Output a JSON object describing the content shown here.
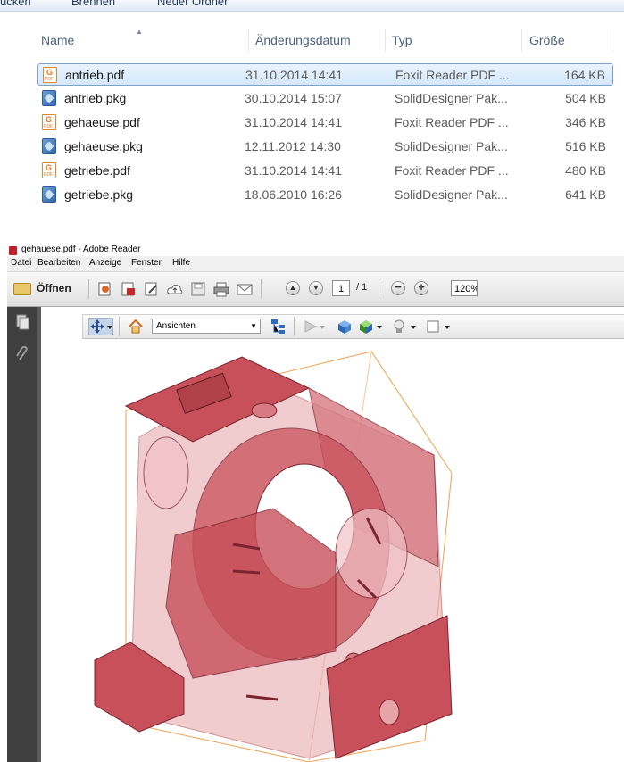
{
  "explorer": {
    "toolbar_items": [
      "ücken",
      "Brennen",
      "Neuer Ordner"
    ],
    "columns": {
      "name": "Name",
      "date": "Änderungsdatum",
      "type": "Typ",
      "size": "Größe"
    },
    "files": [
      {
        "name": "antrieb.pdf",
        "date": "31.10.2014 14:41",
        "type": "Foxit Reader PDF ...",
        "size": "164 KB",
        "icon": "pdf-icon",
        "selected": true
      },
      {
        "name": "antrieb.pkg",
        "date": "30.10.2014 15:07",
        "type": "SolidDesigner Pak...",
        "size": "504 KB",
        "icon": "pkg-icon",
        "selected": false
      },
      {
        "name": "gehaeuse.pdf",
        "date": "31.10.2014 14:41",
        "type": "Foxit Reader PDF ...",
        "size": "346 KB",
        "icon": "pdf-icon",
        "selected": false
      },
      {
        "name": "gehaeuse.pkg",
        "date": "12.11.2012 14:30",
        "type": "SolidDesigner Pak...",
        "size": "516 KB",
        "icon": "pkg-icon",
        "selected": false
      },
      {
        "name": "getriebe.pdf",
        "date": "31.10.2014 14:41",
        "type": "Foxit Reader PDF ...",
        "size": "480 KB",
        "icon": "pdf-icon",
        "selected": false
      },
      {
        "name": "getriebe.pkg",
        "date": "18.06.2010 16:26",
        "type": "SolidDesigner Pak...",
        "size": "641 KB",
        "icon": "pkg-icon",
        "selected": false
      }
    ]
  },
  "reader": {
    "window_title": "gehauese.pdf - Adobe Reader",
    "menu": [
      "Datei",
      "Bearbeiten",
      "Anzeige",
      "Fenster",
      "Hilfe"
    ],
    "open_label": "Öffnen",
    "page_current": "1",
    "page_total": "/ 1",
    "zoom": "120%",
    "views_label": "Ansichten",
    "colors": {
      "model_fill": "#c8505a",
      "model_light": "#e6a3a8",
      "bbox": "#f0a050"
    }
  }
}
